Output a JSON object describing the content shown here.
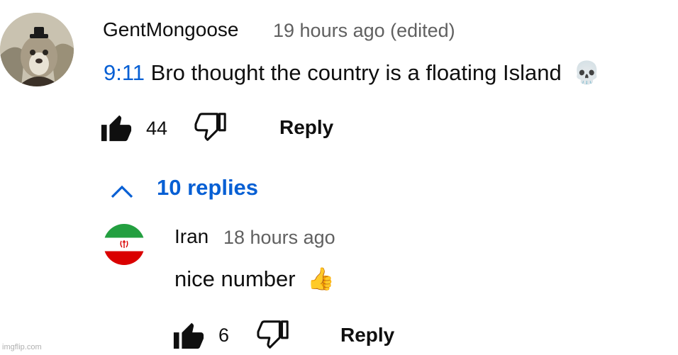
{
  "comment": {
    "author": "GentMongoose",
    "time": "19 hours ago (edited)",
    "timestamp": "9:11",
    "text": "Bro thought the country is a floating Island",
    "emoji": "💀",
    "likes": "44",
    "reply_label": "Reply"
  },
  "replies_toggle": {
    "label": "10 replies"
  },
  "reply": {
    "author": "Iran",
    "time": "18 hours ago",
    "text": "nice number",
    "emoji": "👍",
    "likes": "6",
    "reply_label": "Reply"
  },
  "watermark": "imgflip.com",
  "colors": {
    "link_blue": "#065fd4",
    "meta_gray": "#606060",
    "text": "#0f0f0f",
    "flag_green": "#239f40",
    "flag_red": "#da0000"
  }
}
